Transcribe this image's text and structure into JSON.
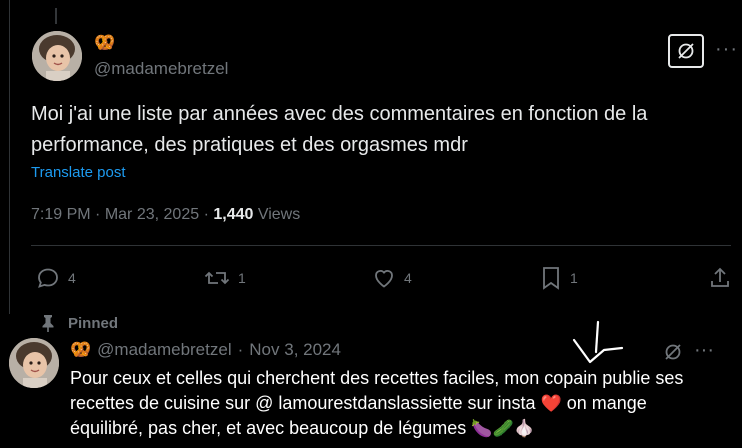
{
  "main_post": {
    "badge_emoji": "🥨",
    "handle": "@madamebretzel",
    "text": "Moi j'ai une liste par années avec des commentaires en fonction de la performance, des pratiques et des orgasmes mdr",
    "translate_label": "Translate post",
    "time": "7:19 PM",
    "date": "Mar 23, 2025",
    "views_count": "1,440",
    "views_label": "Views",
    "actions": {
      "replies": "4",
      "reposts": "1",
      "likes": "4",
      "bookmarks": "1"
    }
  },
  "pinned_post": {
    "pinned_label": "Pinned",
    "badge_emoji": "🥨",
    "handle": "@madamebretzel",
    "separator": "·",
    "date": "Nov 3, 2024",
    "text": "Pour ceux et celles qui cherchent des recettes faciles, mon copain publie ses recettes de cuisine sur @ lamourestdanslassiette sur insta",
    "text_after_heart": "on mange équilibré, pas cher, et avec beaucoup de légumes",
    "emojis": {
      "heart": "❤️",
      "veggies": "🍆🥒🧄"
    }
  },
  "colors": {
    "background": "#000000",
    "text": "#e7e9ea",
    "muted": "#71767b",
    "link": "#1d9bf0",
    "divider": "#2f3336"
  }
}
